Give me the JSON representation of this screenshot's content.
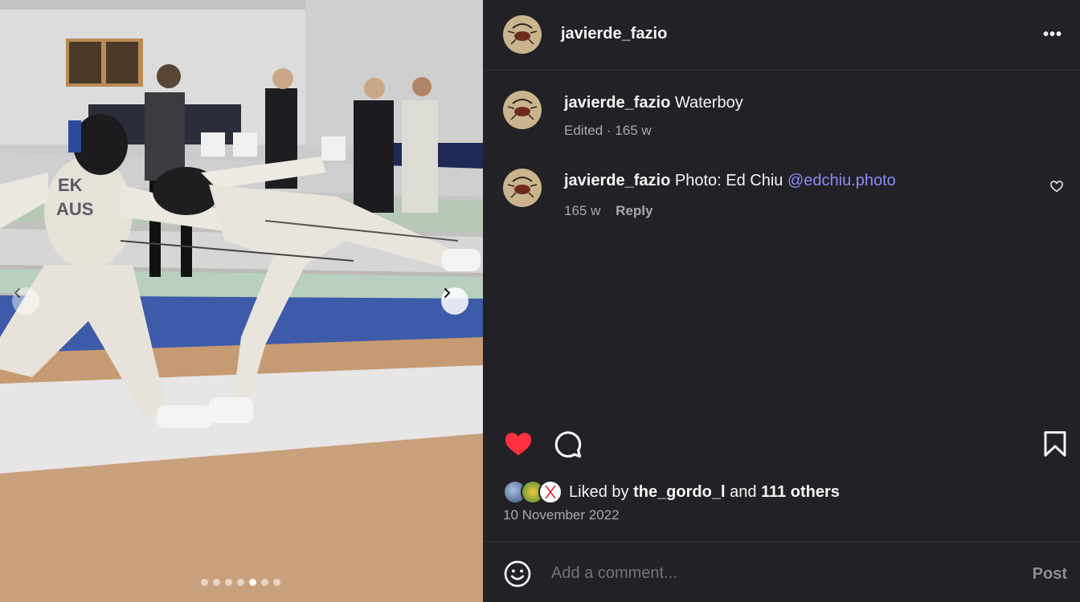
{
  "post": {
    "username": "javierde_fazio",
    "more_label": "•••",
    "media": {
      "slide_count": 7,
      "active_slide": 5,
      "jacket_text_line1": "EK",
      "jacket_text_line2": "AUS"
    }
  },
  "comments": [
    {
      "username": "javierde_fazio",
      "text": "Waterboy",
      "meta_time": "Edited · 165 w"
    },
    {
      "username": "javierde_fazio",
      "text": "Photo: Ed Chiu",
      "mention": "@edchiu.photo",
      "meta_time": "165 w",
      "reply_label": "Reply"
    }
  ],
  "likes": {
    "prefix": "Liked by",
    "first_user": "the_gordo_l",
    "and": "and",
    "others": "111 others"
  },
  "date": "10 November 2022",
  "composer": {
    "placeholder": "Add a comment...",
    "post_label": "Post"
  },
  "icons": {
    "like": "heart-filled-icon",
    "comment": "comment-bubble-icon",
    "save": "bookmark-icon",
    "emoji": "smiley-icon",
    "more": "more-horizontal-icon",
    "prev": "chevron-left-icon",
    "next": "chevron-right-icon"
  },
  "colors": {
    "panel_bg": "#212126",
    "like_red": "#ff3040",
    "mention": "#8a8cf5",
    "muted_text": "#a8a8ad"
  }
}
